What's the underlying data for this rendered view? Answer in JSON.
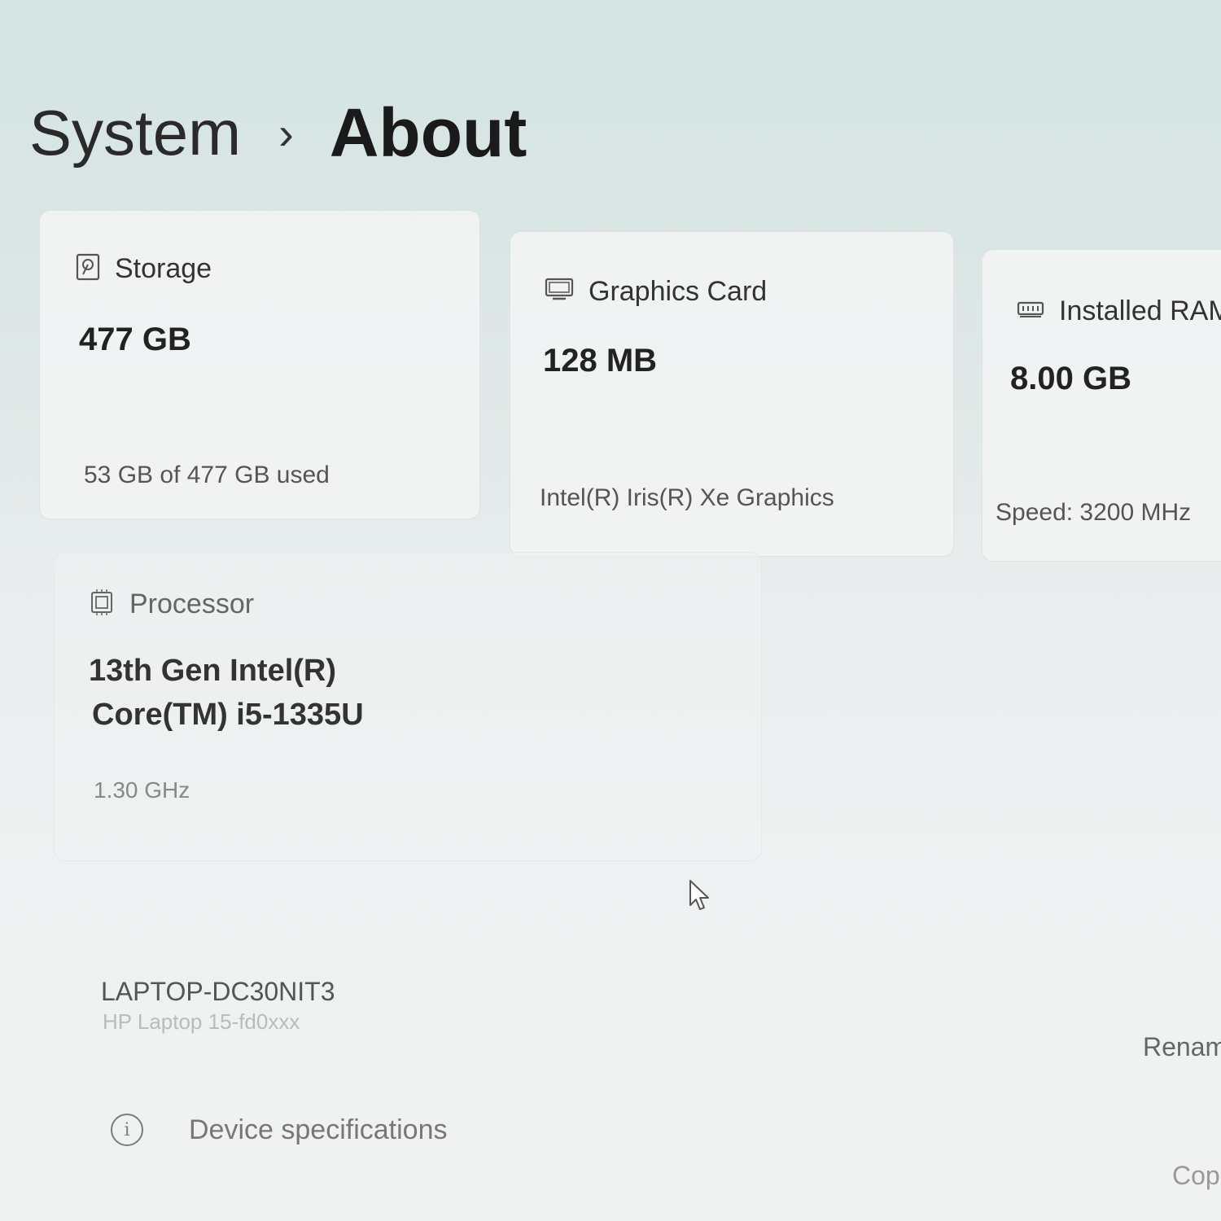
{
  "breadcrumb": {
    "parent": "System",
    "separator": "›",
    "current": "About"
  },
  "cards": {
    "storage": {
      "icon": "hard-drive-icon",
      "label": "Storage",
      "value": "477 GB",
      "detail": "53 GB of 477 GB used"
    },
    "graphics": {
      "icon": "monitor-icon",
      "label": "Graphics Card",
      "value": "128 MB",
      "detail": "Intel(R) Iris(R) Xe Graphics"
    },
    "ram": {
      "icon": "memory-icon",
      "label": "Installed RAM",
      "value": "8.00 GB",
      "detail": "Speed: 3200 MHz"
    },
    "processor": {
      "icon": "processor-icon",
      "label": "Processor",
      "value_line1": "13th Gen Intel(R)",
      "value_line2": "Core(TM) i5-1335U",
      "detail": "1.30 GHz"
    }
  },
  "device": {
    "name": "LAPTOP-DC30NIT3",
    "model": "HP Laptop 15-fd0xxx",
    "rename_label": "Renam"
  },
  "specs_section": {
    "icon": "info-icon",
    "label": "Device specifications",
    "copy_label": "Cop"
  }
}
